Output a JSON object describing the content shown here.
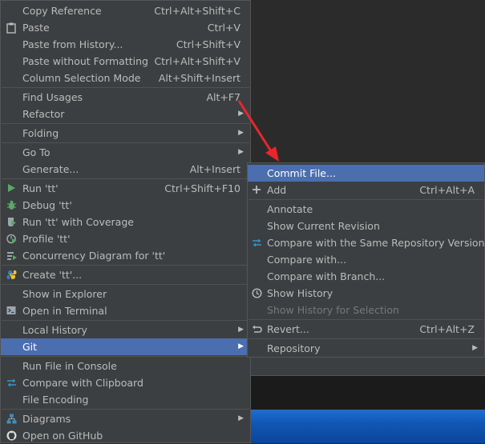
{
  "main_menu": {
    "items": [
      {
        "label": "Copy Reference",
        "shortcut": "Ctrl+Alt+Shift+C"
      },
      {
        "label": "Paste",
        "shortcut": "Ctrl+V",
        "icon": "clipboard-icon"
      },
      {
        "label": "Paste from History...",
        "shortcut": "Ctrl+Shift+V"
      },
      {
        "label": "Paste without Formatting",
        "shortcut": "Ctrl+Alt+Shift+V"
      },
      {
        "label": "Column Selection Mode",
        "shortcut": "Alt+Shift+Insert"
      },
      {
        "label": "Find Usages",
        "shortcut": "Alt+F7"
      },
      {
        "label": "Refactor",
        "submenu": true
      },
      {
        "label": "Folding",
        "submenu": true
      },
      {
        "label": "Go To",
        "submenu": true
      },
      {
        "label": "Generate...",
        "shortcut": "Alt+Insert"
      },
      {
        "label": "Run 'tt'",
        "shortcut": "Ctrl+Shift+F10",
        "icon": "run-icon"
      },
      {
        "label": "Debug 'tt'",
        "icon": "debug-icon"
      },
      {
        "label": "Run 'tt' with Coverage",
        "icon": "coverage-icon"
      },
      {
        "label": "Profile 'tt'",
        "icon": "profile-icon"
      },
      {
        "label": "Concurrency Diagram for 'tt'",
        "icon": "concurrency-icon"
      },
      {
        "label": "Create 'tt'...",
        "icon": "python-icon"
      },
      {
        "label": "Show in Explorer"
      },
      {
        "label": "Open in Terminal",
        "icon": "terminal-icon"
      },
      {
        "label": "Local History",
        "submenu": true
      },
      {
        "label": "Git",
        "submenu": true,
        "selected": true
      },
      {
        "label": "Run File in Console"
      },
      {
        "label": "Compare with Clipboard",
        "icon": "compare-icon"
      },
      {
        "label": "File Encoding"
      },
      {
        "label": "Diagrams",
        "submenu": true,
        "icon": "diagram-icon"
      },
      {
        "label": "Open on GitHub",
        "icon": "github-icon"
      }
    ]
  },
  "git_menu": {
    "items": [
      {
        "label": "Commit File...",
        "selected": true
      },
      {
        "label": "Add",
        "shortcut": "Ctrl+Alt+A",
        "icon": "plus-icon"
      },
      {
        "label": "Annotate"
      },
      {
        "label": "Show Current Revision"
      },
      {
        "label": "Compare with the Same Repository Version",
        "icon": "compare-arrows-icon"
      },
      {
        "label": "Compare with..."
      },
      {
        "label": "Compare with Branch..."
      },
      {
        "label": "Show History",
        "icon": "clock-icon"
      },
      {
        "label": "Show History for Selection",
        "disabled": true
      },
      {
        "label": "Revert...",
        "shortcut": "Ctrl+Alt+Z",
        "icon": "revert-icon"
      },
      {
        "label": "Repository",
        "submenu": true
      }
    ]
  },
  "colors": {
    "menu_bg": "#3c3f41",
    "selection": "#4b6eaf",
    "text": "#bbbbbb",
    "disabled": "#777777",
    "annotation_arrow": "#e8262c"
  },
  "submenu_glyph": "▶"
}
